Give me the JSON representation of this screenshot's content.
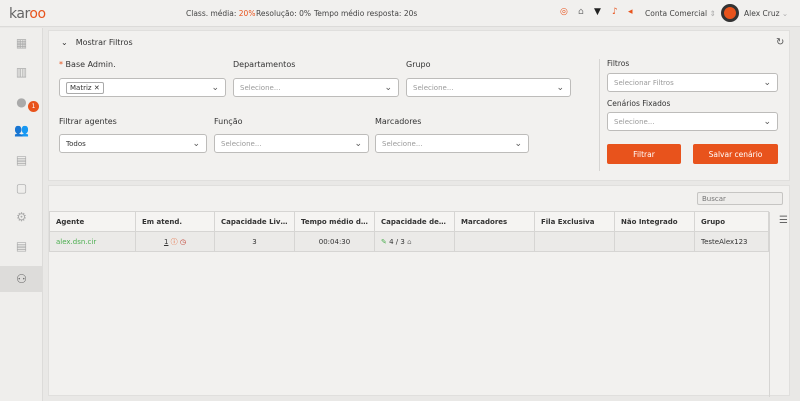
{
  "header": {
    "logo": "karoo",
    "stats": [
      {
        "label": "Class. média:",
        "value": "20%"
      },
      {
        "label": "Resolução:",
        "value": "0%"
      },
      {
        "label": "Tempo médio resposta:",
        "value": "20s"
      }
    ],
    "account": "Conta Comercial",
    "user": "Alex Cruz"
  },
  "sidebar": {
    "badge": "1"
  },
  "filters": {
    "toggle": "Mostrar Filtros",
    "base_admin": {
      "label": "Base Admin.",
      "tag": "Matriz"
    },
    "departamentos": {
      "label": "Departamentos",
      "placeholder": "Selecione..."
    },
    "grupo": {
      "label": "Grupo",
      "placeholder": "Selecione..."
    },
    "filtrar_agentes": {
      "label": "Filtrar agentes",
      "value": "Todos"
    },
    "funcao": {
      "label": "Função",
      "placeholder": "Selecione..."
    },
    "marcadores": {
      "label": "Marcadores",
      "placeholder": "Selecione..."
    },
    "filtros": {
      "label": "Filtros",
      "placeholder": "Selecionar Filtros"
    },
    "cenarios": {
      "label": "Cenários Fixados",
      "placeholder": "Selecione..."
    },
    "filtrar_btn": "Filtrar",
    "salvar_btn": "Salvar cenário"
  },
  "table": {
    "search_placeholder": "Buscar",
    "columns": [
      "Agente",
      "Em atend.",
      "Capacidade Livre",
      "Tempo médio de ...",
      "Capacidade de at...",
      "Marcadores",
      "Fila Exclusiva",
      "Não Integrado",
      "Grupo"
    ],
    "rows": [
      {
        "agente": "alex.dsn.cir",
        "em_atend": "1",
        "cap_livre": "3",
        "tempo": "00:04:30",
        "capacidade": "4 / 3",
        "marcadores": "",
        "fila": "",
        "nao_integrado": "",
        "grupo": "TesteAlex123"
      }
    ]
  },
  "colors": {
    "accent": "#e8531c",
    "link": "#4caf50"
  }
}
